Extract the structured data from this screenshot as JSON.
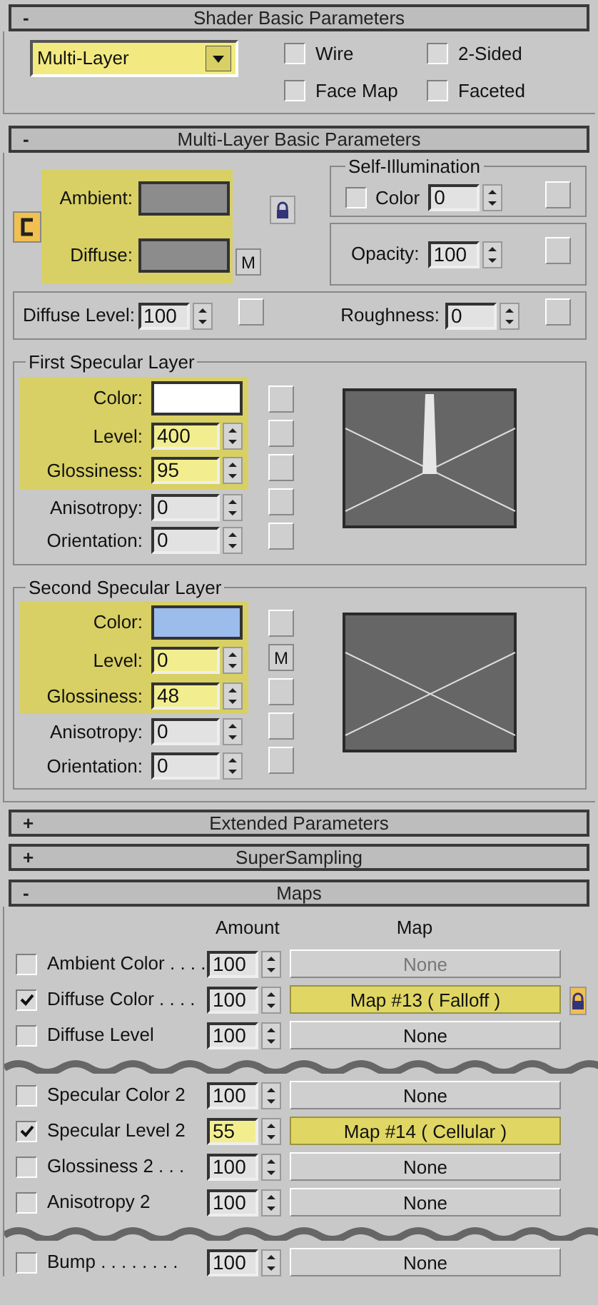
{
  "shader_basic": {
    "sign": "-",
    "title": "Shader Basic Parameters",
    "shader": {
      "value": "Multi-Layer",
      "highlighted": true
    },
    "checkboxes": [
      {
        "label": "Wire",
        "checked": false
      },
      {
        "label": "2-Sided",
        "checked": false
      },
      {
        "label": "Face Map",
        "checked": false
      },
      {
        "label": "Faceted",
        "checked": false
      }
    ]
  },
  "multilayer_basic": {
    "sign": "-",
    "title": "Multi-Layer Basic Parameters",
    "highlighted": true,
    "ambient": {
      "label": "Ambient:",
      "color": "#8c8c8c"
    },
    "diffuse": {
      "label": "Diffuse:",
      "color": "#8c8c8c"
    },
    "map_button": "M",
    "self_illumination": {
      "title": "Self-Illumination",
      "label": "Color",
      "checked": false,
      "value": "0"
    },
    "opacity": {
      "label": "Opacity:",
      "value": "100"
    },
    "diffuse_level": {
      "label": "Diffuse Level:",
      "value": "100"
    },
    "roughness": {
      "label": "Roughness:",
      "value": "0"
    },
    "layers": [
      {
        "title": "First Specular Layer",
        "spike": true,
        "color": {
          "label": "Color:",
          "color": "#ffffff",
          "highlighted": true
        },
        "rows": [
          {
            "label": "Level:",
            "value": "400",
            "highlighted": true
          },
          {
            "label": "Glossiness:",
            "value": "95",
            "highlighted": true
          },
          {
            "label": "Anisotropy:",
            "value": "0",
            "highlighted": false
          },
          {
            "label": "Orientation:",
            "value": "0",
            "highlighted": false
          }
        ]
      },
      {
        "title": "Second Specular Layer",
        "spike": false,
        "color": {
          "label": "Color:",
          "color": "#9cbcec",
          "highlighted": true
        },
        "rows": [
          {
            "label": "Level:",
            "value": "0",
            "highlighted": true,
            "map_button": "M"
          },
          {
            "label": "Glossiness:",
            "value": "48",
            "highlighted": true
          },
          {
            "label": "Anisotropy:",
            "value": "0",
            "highlighted": false
          },
          {
            "label": "Orientation:",
            "value": "0",
            "highlighted": false
          }
        ]
      }
    ]
  },
  "collapsed_rollouts": [
    {
      "sign": "+",
      "title": "Extended Parameters"
    },
    {
      "sign": "+",
      "title": "SuperSampling"
    }
  ],
  "maps": {
    "sign": "-",
    "title": "Maps",
    "columns": [
      "Amount",
      "Map"
    ],
    "rows": [
      {
        "kind": "map",
        "label": "Ambient Color . . . .",
        "checked": false,
        "amount": "100",
        "map": "None",
        "assigned": false,
        "highlighted": false
      },
      {
        "kind": "map",
        "label": "Diffuse Color . . . .",
        "checked": true,
        "amount": "100",
        "map": "Map #13  ( Falloff )",
        "assigned": true,
        "highlighted": false
      },
      {
        "kind": "map",
        "label": "Diffuse Level",
        "checked": false,
        "amount": "100",
        "map": "None",
        "assigned": false,
        "highlighted": false
      },
      {
        "kind": "break"
      },
      {
        "kind": "map",
        "label": "Specular Color 2",
        "checked": false,
        "amount": "100",
        "map": "None",
        "assigned": false,
        "highlighted": false
      },
      {
        "kind": "map",
        "label": "Specular Level 2",
        "checked": true,
        "amount": "55",
        "map": "Map #14  ( Cellular )",
        "assigned": true,
        "highlighted": true
      },
      {
        "kind": "map",
        "label": "Glossiness 2 . . .",
        "checked": false,
        "amount": "100",
        "map": "None",
        "assigned": false,
        "highlighted": false
      },
      {
        "kind": "map",
        "label": "Anisotropy 2",
        "checked": false,
        "amount": "100",
        "map": "None",
        "assigned": false,
        "highlighted": false
      },
      {
        "kind": "break"
      },
      {
        "kind": "map",
        "label": "Bump . . . . . . . .",
        "checked": false,
        "amount": "100",
        "map": "None",
        "assigned": false,
        "highlighted": false
      }
    ]
  }
}
